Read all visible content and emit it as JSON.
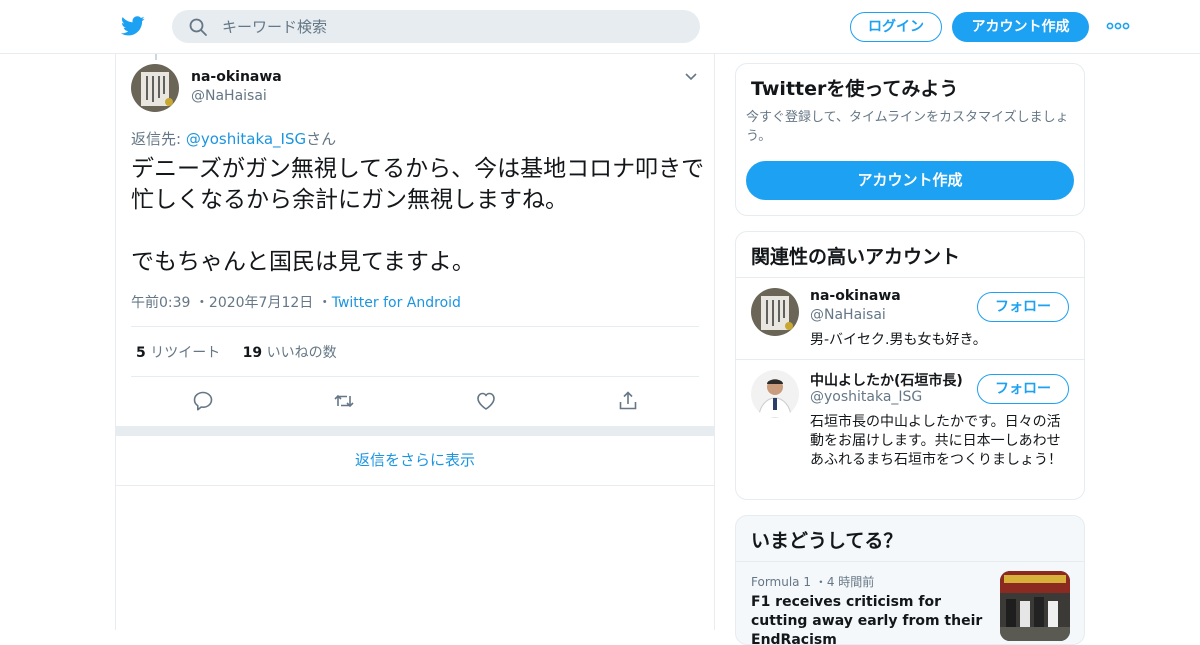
{
  "header": {
    "search_placeholder": "キーワード検索",
    "login_label": "ログイン",
    "signup_label": "アカウント作成"
  },
  "tweet": {
    "author_name": "na-okinawa",
    "author_handle": "@NaHaisai",
    "reply_prefix": "返信先: ",
    "reply_mention": "@yoshitaka_ISG",
    "reply_suffix": "さん",
    "text": "デニーズがガン無視してるから、今は基地コロナ叩きで忙しくなるから余計にガン無視しますね。\n\nでもちゃんと国民は見てますよ。",
    "time": "午前0:39",
    "date": "2020年7月12日",
    "source": "Twitter for Android",
    "retweet_count": "5",
    "retweet_label": " リツイート",
    "like_count": "19",
    "like_label": " いいねの数"
  },
  "more_replies_label": "返信をさらに表示",
  "signup_card": {
    "title": "Twitterを使ってみよう",
    "description": "今すぐ登録して、タイムラインをカスタマイズしましょう。",
    "cta": "アカウント作成"
  },
  "related": {
    "title": "関連性の高いアカウント",
    "accounts": [
      {
        "name": "na-okinawa",
        "handle": "@NaHaisai",
        "bio": "男-バイセク.男も女も好き。",
        "follow_label": "フォロー"
      },
      {
        "name": "中山よしたか(石垣市長)",
        "handle": "@yoshitaka_ISG",
        "bio": "石垣市長の中山よしたかです。日々の活動をお届けします。共に日本一しあわせあふれるまち石垣市をつくりましょう！",
        "follow_label": "フォロー"
      }
    ]
  },
  "trends": {
    "title": "いまどうしてる？",
    "items": [
      {
        "category": "Formula 1",
        "time": "4 時間前",
        "headline": "F1 receives criticism for cutting away early from their EndRacism"
      }
    ]
  },
  "colors": {
    "brand": "#1da1f2",
    "link": "#1b95e0",
    "muted": "#657786",
    "border": "#e6ecf0"
  }
}
